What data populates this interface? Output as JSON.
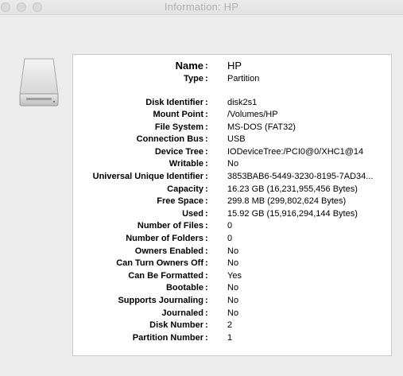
{
  "window": {
    "title": "Information: HP"
  },
  "icon": "external-drive-icon",
  "fields": [
    {
      "label": "Name",
      "value": "HP"
    },
    {
      "label": "Type",
      "value": "Partition"
    },
    {
      "label": "Disk Identifier",
      "value": "disk2s1"
    },
    {
      "label": "Mount Point",
      "value": "/Volumes/HP"
    },
    {
      "label": "File System",
      "value": "MS-DOS (FAT32)"
    },
    {
      "label": "Connection Bus",
      "value": "USB"
    },
    {
      "label": "Device Tree",
      "value": "IODeviceTree:/PCI0@0/XHC1@14"
    },
    {
      "label": "Writable",
      "value": "No"
    },
    {
      "label": "Universal Unique Identifier",
      "value": "3853BAB6-5449-3230-8195-7AD34..."
    },
    {
      "label": "Capacity",
      "value": "16.23 GB (16,231,955,456 Bytes)"
    },
    {
      "label": "Free Space",
      "value": "299.8 MB (299,802,624 Bytes)"
    },
    {
      "label": "Used",
      "value": "15.92 GB (15,916,294,144 Bytes)"
    },
    {
      "label": "Number of Files",
      "value": "0"
    },
    {
      "label": "Number of Folders",
      "value": "0"
    },
    {
      "label": "Owners Enabled",
      "value": "No"
    },
    {
      "label": "Can Turn Owners Off",
      "value": "No"
    },
    {
      "label": "Can Be Formatted",
      "value": "Yes"
    },
    {
      "label": "Bootable",
      "value": "No"
    },
    {
      "label": "Supports Journaling",
      "value": "No"
    },
    {
      "label": "Journaled",
      "value": "No"
    },
    {
      "label": "Disk Number",
      "value": "2"
    },
    {
      "label": "Partition Number",
      "value": "1"
    }
  ]
}
